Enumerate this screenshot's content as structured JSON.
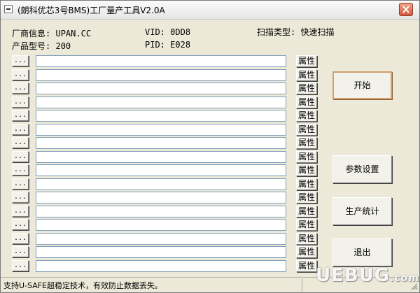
{
  "window": {
    "title": "(朗科优芯3号BMS)工厂量产工具V2.0A"
  },
  "info": {
    "vendor_label": "厂商信息:",
    "vendor_value": "UPAN.CC",
    "vid_label": "VID:",
    "vid_value": "0DD8",
    "scan_label": "扫描类型:",
    "scan_value": "快速扫描",
    "product_label": "产品型号:",
    "product_value": "200",
    "pid_label": "PID:",
    "pid_value": "E028"
  },
  "ports": {
    "dots_label": "...",
    "property_label": "属性",
    "rows": [
      "",
      "",
      "",
      "",
      "",
      "",
      "",
      "",
      "",
      "",
      "",
      "",
      "",
      "",
      "",
      ""
    ]
  },
  "actions": {
    "start": "开始",
    "settings": "参数设置",
    "stats": "生产统计",
    "exit": "退出"
  },
  "status": {
    "text": "支持U-SAFE超稳定技术，有效防止数据丢失。"
  },
  "watermark": {
    "text": "UEBUG",
    "suffix": ".com"
  }
}
